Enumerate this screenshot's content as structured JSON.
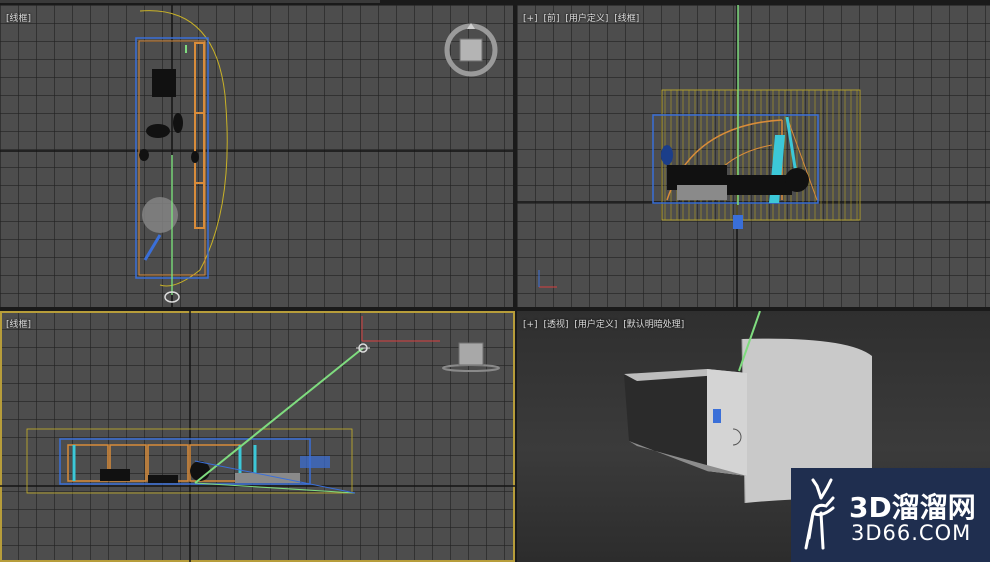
{
  "viewports": {
    "top_left": {
      "labels": [
        "[线框]"
      ]
    },
    "top_right": {
      "labels": [
        "[+]",
        "[前]",
        "[用户定义]",
        "[线框]"
      ]
    },
    "bottom_left": {
      "labels": [
        "[线框]"
      ]
    },
    "bottom_right": {
      "labels": [
        "[+]",
        "[透视]",
        "[用户定义]",
        "[默认明暗处理]"
      ]
    }
  },
  "watermark": {
    "brand": "3D溜溜网",
    "site": "3D66.COM"
  },
  "icons": [
    "viewcube-icon",
    "camera-icon",
    "light-icon",
    "axis-gizmo-icon",
    "deer-logo-icon"
  ],
  "colors": {
    "grid_bg": "#4d4d4d",
    "wire_orange": "#d98c3a",
    "wire_blue": "#3a6fd8",
    "wire_yellow": "#c9b227",
    "camera_green": "#7fdc7f",
    "active_border": "#b79d3a",
    "logo_bg": "#1f2e4f"
  }
}
